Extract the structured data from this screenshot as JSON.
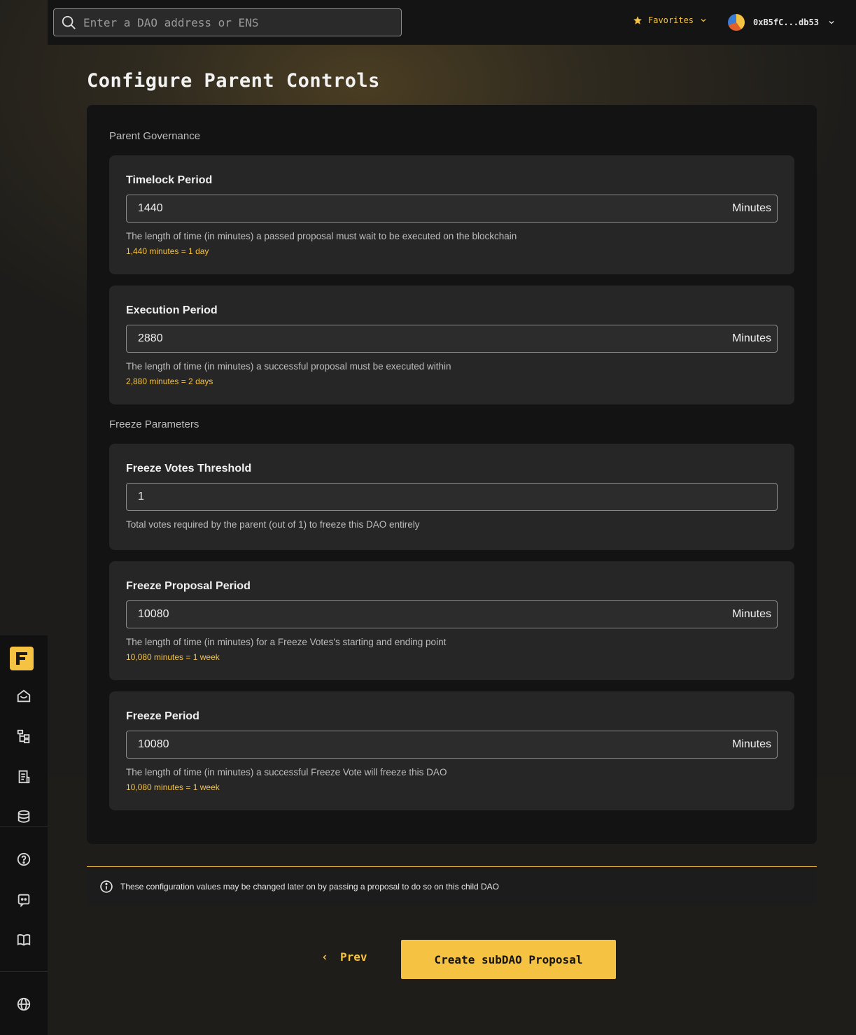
{
  "header": {
    "search_placeholder": "Enter a DAO address or ENS",
    "favorites_label": "Favorites",
    "account_label": "0xB5fC...db53"
  },
  "page": {
    "title": "Configure Parent Controls"
  },
  "sections": {
    "parent_governance": "Parent Governance",
    "freeze_parameters": "Freeze Parameters"
  },
  "fields": [
    {
      "label": "Timelock Period",
      "value": "1440",
      "unit": "Minutes",
      "help": "The length of time (in minutes) a passed proposal must wait to be executed on the blockchain",
      "hint": "1,440 minutes = 1 day"
    },
    {
      "label": "Execution Period",
      "value": "2880",
      "unit": "Minutes",
      "help": "The length of time (in minutes) a successful proposal must be executed within",
      "hint": "2,880 minutes = 2 days"
    },
    {
      "label": "Freeze Votes Threshold",
      "value": "1",
      "unit": "",
      "help": "Total votes required by the parent (out of 1) to freeze this DAO entirely",
      "hint": ""
    },
    {
      "label": "Freeze Proposal Period",
      "value": "10080",
      "unit": "Minutes",
      "help": "The length of time (in minutes) for a Freeze Votes's starting and ending point",
      "hint": "10,080 minutes = 1 week"
    },
    {
      "label": "Freeze Period",
      "value": "10080",
      "unit": "Minutes",
      "help": "The length of time (in minutes) a successful Freeze Vote will freeze this DAO",
      "hint": "10,080 minutes = 1 week"
    }
  ],
  "info": {
    "text": "These configuration values may be changed later on by passing a proposal to do so on this child DAO"
  },
  "actions": {
    "prev_label": "Prev",
    "create_label": "Create subDAO Proposal"
  },
  "sidebar": {
    "logo_letter": "F",
    "icons": [
      "home-icon",
      "hierarchy-icon",
      "proposals-icon",
      "treasury-icon",
      "help-icon",
      "discord-icon",
      "docs-icon",
      "globe-icon"
    ]
  },
  "colors": {
    "accent": "#f5c242",
    "panel": "#131313",
    "card": "#262626"
  }
}
